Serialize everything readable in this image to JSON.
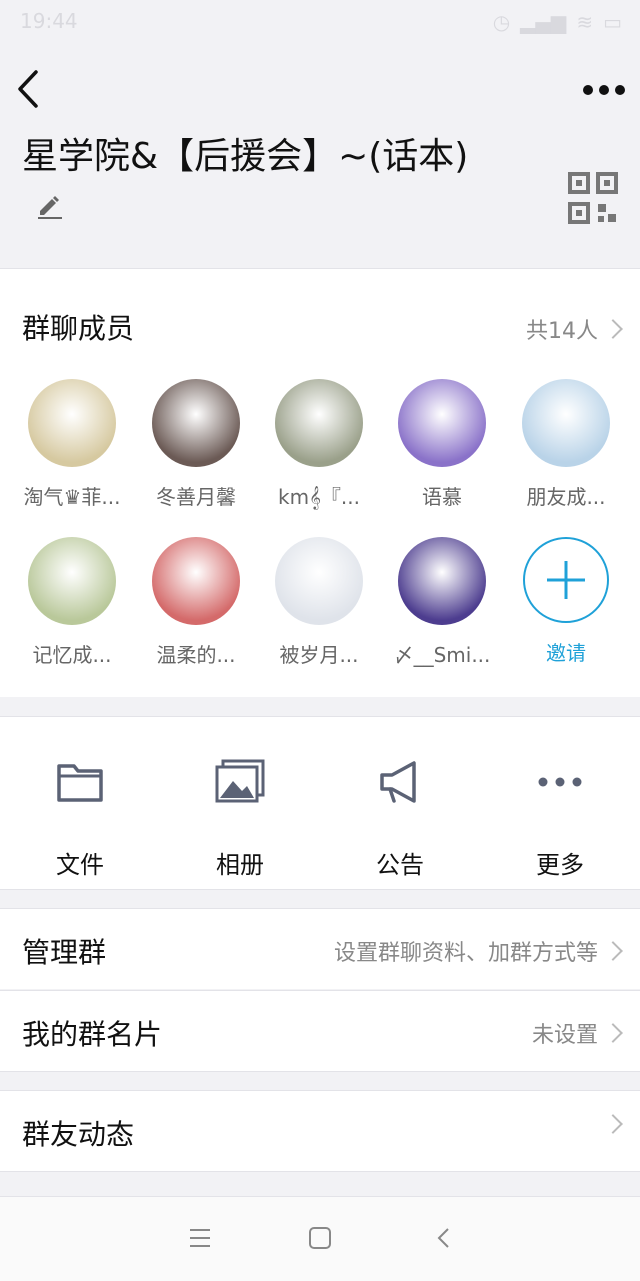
{
  "status": {
    "time": "19:44"
  },
  "header": {
    "title": "星学院&【后援会】~(话本)"
  },
  "members": {
    "section_title": "群聊成员",
    "count_label": "共14人",
    "list": [
      {
        "name": "淘气♛菲...",
        "color": "#d6c9a0"
      },
      {
        "name": "冬善月馨",
        "color": "#6b5a55"
      },
      {
        "name": "km𝄞『...",
        "color": "#9aa08a"
      },
      {
        "name": "语慕",
        "color": "#8a72c9"
      },
      {
        "name": "朋友成...",
        "color": "#b9d3e8"
      },
      {
        "name": "记忆成...",
        "color": "#b9c89a"
      },
      {
        "name": "温柔的...",
        "color": "#d46a6a"
      },
      {
        "name": "被岁月...",
        "color": "#dfe3ea"
      },
      {
        "name": "〆__Smi...",
        "color": "#4d3d8f"
      }
    ],
    "invite_label": "邀请"
  },
  "actions": [
    {
      "label": "文件",
      "icon": "folder-icon"
    },
    {
      "label": "相册",
      "icon": "album-icon"
    },
    {
      "label": "公告",
      "icon": "megaphone-icon"
    },
    {
      "label": "更多",
      "icon": "more-dots-icon"
    }
  ],
  "rows": {
    "manage": {
      "label": "管理群",
      "value": "设置群聊资料、加群方式等"
    },
    "card": {
      "label": "我的群名片",
      "value": "未设置"
    },
    "feed": {
      "label": "群友动态"
    }
  },
  "colors": {
    "accent": "#1fa1d8",
    "icon_gray": "#5b6275"
  }
}
